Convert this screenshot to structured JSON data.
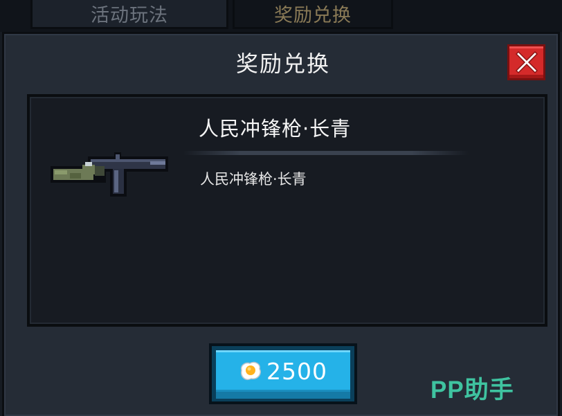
{
  "tabs": [
    {
      "label": "活动玩法"
    },
    {
      "label": "奖励兑换"
    }
  ],
  "dialog": {
    "title": "奖励兑换",
    "close_icon": "close-x-icon"
  },
  "item": {
    "name": "人民冲锋枪·长青",
    "description": "人民冲锋枪·长青",
    "icon": "submachine-gun-icon"
  },
  "price": {
    "currency_icon": "fried-egg-icon",
    "value": "2500"
  },
  "watermark": "PP助手",
  "colors": {
    "close_button": "#d42a2a",
    "price_button": "#25b2e8",
    "watermark": "#3fc3a0"
  }
}
